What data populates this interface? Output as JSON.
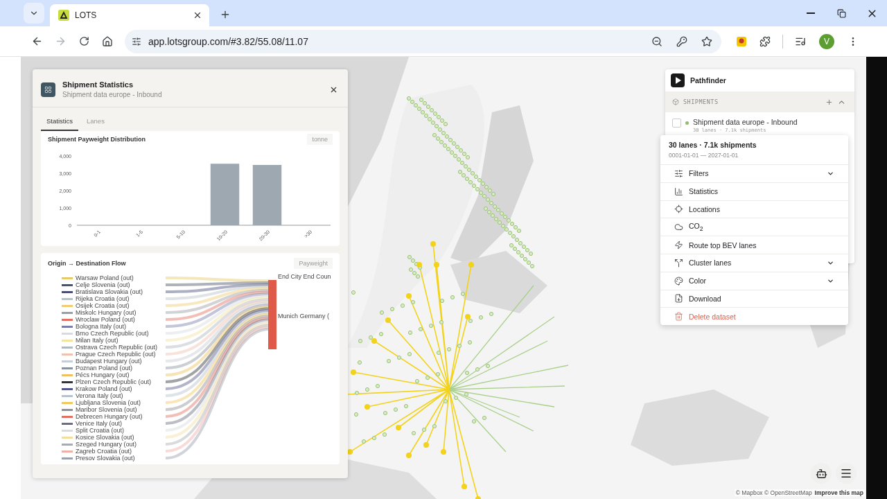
{
  "browser": {
    "tab": {
      "title": "LOTS"
    },
    "address": "app.lotsgroup.com/#3.82/55.08/11.07",
    "forward_disabled": true,
    "avatar": "V"
  },
  "stats_panel": {
    "title": "Shipment Statistics",
    "subtitle": "Shipment data europe - Inbound",
    "tabs": [
      {
        "label": "Statistics",
        "selected": true
      },
      {
        "label": "Lanes",
        "selected": false
      }
    ],
    "distribution": {
      "title": "Shipment Payweight Distribution",
      "unit": "tonne",
      "chart_data": {
        "type": "bar",
        "categories": [
          "0-1",
          "1-5",
          "5-10",
          "10-20",
          "20-30",
          ">30"
        ],
        "series": [
          {
            "color": "#9ea8b1",
            "values": [
              0,
              0,
              0,
              3550,
              3480,
              0
            ]
          }
        ],
        "ylim": [
          0,
          4000
        ],
        "yticks": [
          {
            "value": 0,
            "label": "0"
          },
          {
            "value": 1000,
            "label": "1,000"
          },
          {
            "value": 2000,
            "label": "2,000"
          },
          {
            "value": 3000,
            "label": "3,000"
          },
          {
            "value": 4000,
            "label": "4,000"
          }
        ]
      }
    },
    "flow": {
      "title": "Origin → Destination Flow",
      "measure": "Payweight",
      "origins": [
        {
          "label": "Warsaw Poland (out)",
          "color": "#e8c96a"
        },
        {
          "label": "Celje Slovenia (out)",
          "color": "#4a5568"
        },
        {
          "label": "Bratislava Slovakia (out)",
          "color": "#4a4f7a"
        },
        {
          "label": "Rijeka Croatia (out)",
          "color": "#b8c0c8"
        },
        {
          "label": "Osijek Croatia (out)",
          "color": "#f0cc70"
        },
        {
          "label": "Miskolc Hungary (out)",
          "color": "#9a9ea5"
        },
        {
          "label": "Wroclaw Poland (out)",
          "color": "#e07060"
        },
        {
          "label": "Bologna Italy (out)",
          "color": "#7a7fa8"
        },
        {
          "label": "Brno Czech Republic (out)",
          "color": "#d8dadf"
        },
        {
          "label": "Milan Italy (out)",
          "color": "#f3e3a0"
        },
        {
          "label": "Ostrava Czech Republic (out)",
          "color": "#b0b8c0"
        },
        {
          "label": "Prague Czech Republic (out)",
          "color": "#f0c0b0"
        },
        {
          "label": "Budapest Hungary (out)",
          "color": "#c8cdd5"
        },
        {
          "label": "Poznan Poland (out)",
          "color": "#8a949e"
        },
        {
          "label": "Pécs Hungary (out)",
          "color": "#f0c060"
        },
        {
          "label": "Plzen Czech Republic (out)",
          "color": "#303338"
        },
        {
          "label": "Krakow Poland (out)",
          "color": "#55588a"
        },
        {
          "label": "Verona Italy (out)",
          "color": "#b8c2cc"
        },
        {
          "label": "Ljubljana Slovenia (out)",
          "color": "#f0c860"
        },
        {
          "label": "Maribor Slovenia (out)",
          "color": "#8e9196"
        },
        {
          "label": "Debrecen Hungary (out)",
          "color": "#e07060"
        },
        {
          "label": "Venice Italy (out)",
          "color": "#6a6e80"
        },
        {
          "label": "Split Croatia (out)",
          "color": "#d8dadd"
        },
        {
          "label": "Kosice Slovakia (out)",
          "color": "#f3dda0"
        },
        {
          "label": "Szeged Hungary (out)",
          "color": "#a8acb2"
        },
        {
          "label": "Zagreb Croatia (out)",
          "color": "#f0b0a8"
        },
        {
          "label": "Presov Slovakia (out)",
          "color": "#9aa2ae"
        }
      ],
      "destinations": [
        {
          "label": "End City End Coun"
        },
        {
          "label": "Munich Germany (",
          "color": "#e05a4a"
        }
      ]
    }
  },
  "pathfinder": {
    "title": "Pathfinder",
    "section": "SHIPMENTS",
    "datasets": [
      {
        "name": "Shipment data europe - Inbound",
        "summary": "30 lanes · 7.1k shipments",
        "checked": false,
        "color": "#8fbf6a"
      }
    ]
  },
  "dataset_menu": {
    "title": "30 lanes · 7.1k shipments",
    "range": "0001-01-01 — 2027-01-01",
    "items": [
      {
        "kind": "filters",
        "label": "Filters",
        "expandable": true
      },
      {
        "kind": "statistics",
        "label": "Statistics",
        "expandable": false
      },
      {
        "kind": "locations",
        "label": "Locations",
        "expandable": false
      },
      {
        "kind": "co2",
        "label": "CO$_{2}$",
        "expandable": false
      },
      {
        "kind": "route",
        "label": "Route top BEV lanes",
        "expandable": false
      },
      {
        "kind": "cluster",
        "label": "Cluster lanes",
        "expandable": true
      },
      {
        "kind": "color",
        "label": "Color",
        "expandable": true
      },
      {
        "kind": "download",
        "label": "Download",
        "expandable": false
      },
      {
        "kind": "delete",
        "label": "Delete dataset",
        "expandable": false
      }
    ]
  },
  "map": {
    "attribution": "© Mapbox © OpenStreetMap",
    "improve_link": "Improve this map"
  }
}
